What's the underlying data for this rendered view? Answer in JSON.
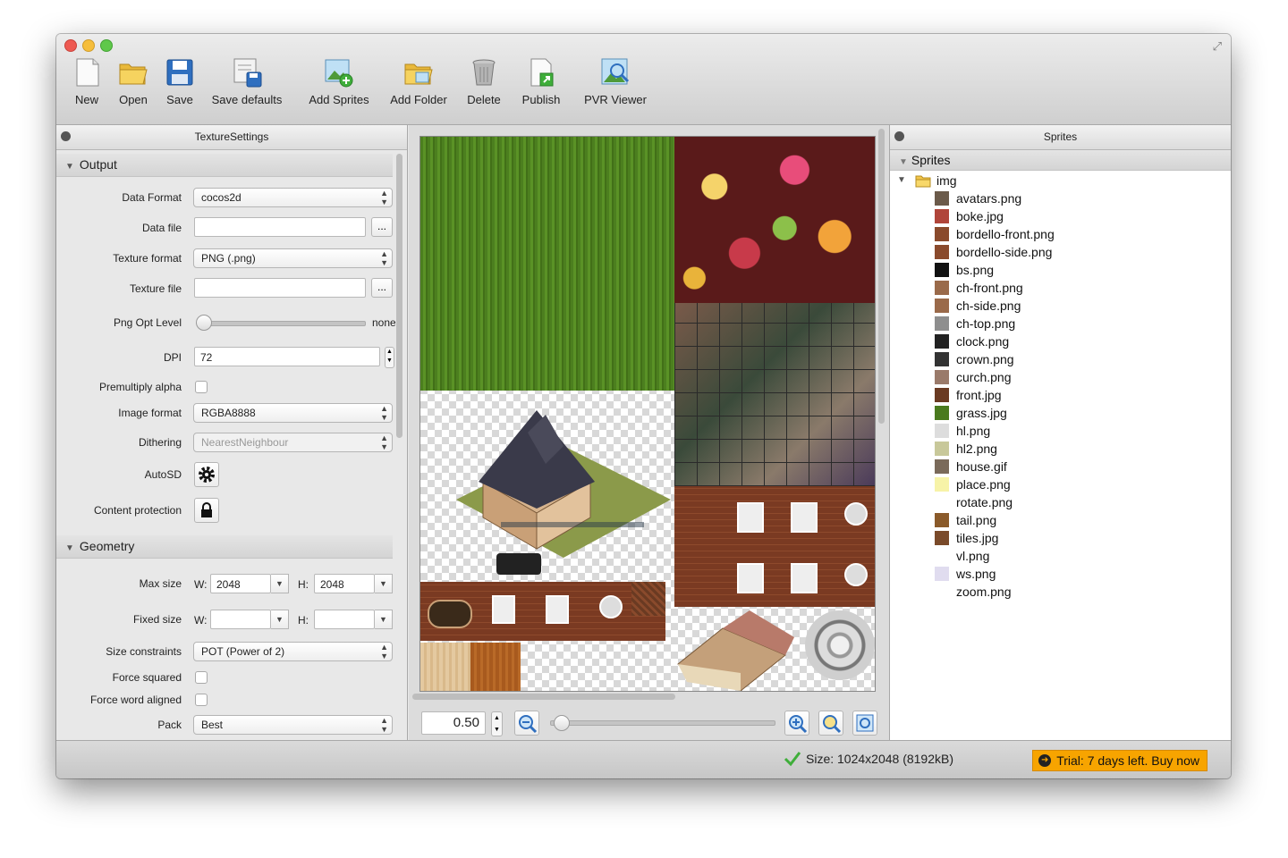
{
  "toolbar": {
    "new": "New",
    "open": "Open",
    "save": "Save",
    "save_defaults": "Save defaults",
    "add_sprites": "Add Sprites",
    "add_folder": "Add Folder",
    "delete": "Delete",
    "publish": "Publish",
    "pvr_viewer": "PVR Viewer"
  },
  "texture_settings": {
    "title": "TextureSettings",
    "output": {
      "heading": "Output",
      "data_format_label": "Data Format",
      "data_format_value": "cocos2d",
      "data_file_label": "Data file",
      "data_file_value": "",
      "texture_format_label": "Texture format",
      "texture_format_value": "PNG (.png)",
      "texture_file_label": "Texture file",
      "texture_file_value": "",
      "browse": "...",
      "png_opt_label": "Png Opt Level",
      "png_opt_value_text": "none",
      "png_opt_level": 0,
      "dpi_label": "DPI",
      "dpi_value": "72",
      "premultiply_label": "Premultiply alpha",
      "premultiply_checked": false,
      "image_format_label": "Image format",
      "image_format_value": "RGBA8888",
      "dithering_label": "Dithering",
      "dithering_value": "NearestNeighbour",
      "autosd_label": "AutoSD",
      "autosd_icon": "gear-icon",
      "content_protection_label": "Content protection",
      "content_protection_icon": "lock-icon"
    },
    "geometry": {
      "heading": "Geometry",
      "max_size_label": "Max size",
      "w_label": "W:",
      "h_label": "H:",
      "max_w": "2048",
      "max_h": "2048",
      "fixed_size_label": "Fixed size",
      "fixed_w": "",
      "fixed_h": "",
      "size_constraints_label": "Size constraints",
      "size_constraints_value": "POT (Power of 2)",
      "force_squared_label": "Force squared",
      "force_word_aligned_label": "Force word aligned",
      "pack_label": "Pack",
      "pack_value": "Best"
    }
  },
  "preview": {
    "zoom_value": "0.50",
    "zoom_level": 0.02
  },
  "sprites": {
    "title": "Sprites",
    "root": "Sprites",
    "folder": "img",
    "items": [
      {
        "name": "avatars.png",
        "icon": "avatars-thumb-icon",
        "color": "#6b5a4a"
      },
      {
        "name": "boke.jpg",
        "icon": "boke-thumb-icon",
        "color": "#b0453a"
      },
      {
        "name": "bordello-front.png",
        "icon": "bordello-front-thumb-icon",
        "color": "#8a4a2c"
      },
      {
        "name": "bordello-side.png",
        "icon": "bordello-side-thumb-icon",
        "color": "#8a4a2c"
      },
      {
        "name": "bs.png",
        "icon": "bs-thumb-icon",
        "color": "#111111"
      },
      {
        "name": "ch-front.png",
        "icon": "ch-front-thumb-icon",
        "color": "#9a6a4a"
      },
      {
        "name": "ch-side.png",
        "icon": "ch-side-thumb-icon",
        "color": "#9a6a4a"
      },
      {
        "name": "ch-top.png",
        "icon": "ch-top-thumb-icon",
        "color": "#8e8e8e"
      },
      {
        "name": "clock.png",
        "icon": "clock-thumb-icon",
        "color": "#222222"
      },
      {
        "name": "crown.png",
        "icon": "crown-thumb-icon",
        "color": "#333333"
      },
      {
        "name": "curch.png",
        "icon": "curch-thumb-icon",
        "color": "#9a7a6a"
      },
      {
        "name": "front.jpg",
        "icon": "front-thumb-icon",
        "color": "#6a3a22"
      },
      {
        "name": "grass.jpg",
        "icon": "grass-thumb-icon",
        "color": "#4a7a1e"
      },
      {
        "name": "hl.png",
        "icon": "hl-thumb-icon",
        "color": "#dddddd"
      },
      {
        "name": "hl2.png",
        "icon": "hl2-thumb-icon",
        "color": "#c8c89a"
      },
      {
        "name": "house.gif",
        "icon": "house-thumb-icon",
        "color": "#7a6a5a"
      },
      {
        "name": "place.png",
        "icon": "place-thumb-icon",
        "color": "#f7f3a8"
      },
      {
        "name": "rotate.png",
        "icon": "rotate-thumb-icon",
        "color": "#ffffff"
      },
      {
        "name": "tail.png",
        "icon": "tail-thumb-icon",
        "color": "#8a5a2a"
      },
      {
        "name": "tiles.jpg",
        "icon": "tiles-thumb-icon",
        "color": "#7a4a2a"
      },
      {
        "name": "vl.png",
        "icon": "vl-thumb-icon",
        "color": "#ffffff"
      },
      {
        "name": "ws.png",
        "icon": "ws-thumb-icon",
        "color": "#e0dcef"
      },
      {
        "name": "zoom.png",
        "icon": "zoom-thumb-icon",
        "color": "#ffffff"
      }
    ]
  },
  "status": {
    "size_text": "Size: 1024x2048 (8192kB)",
    "trial_text": "Trial: 7 days left. Buy now"
  }
}
